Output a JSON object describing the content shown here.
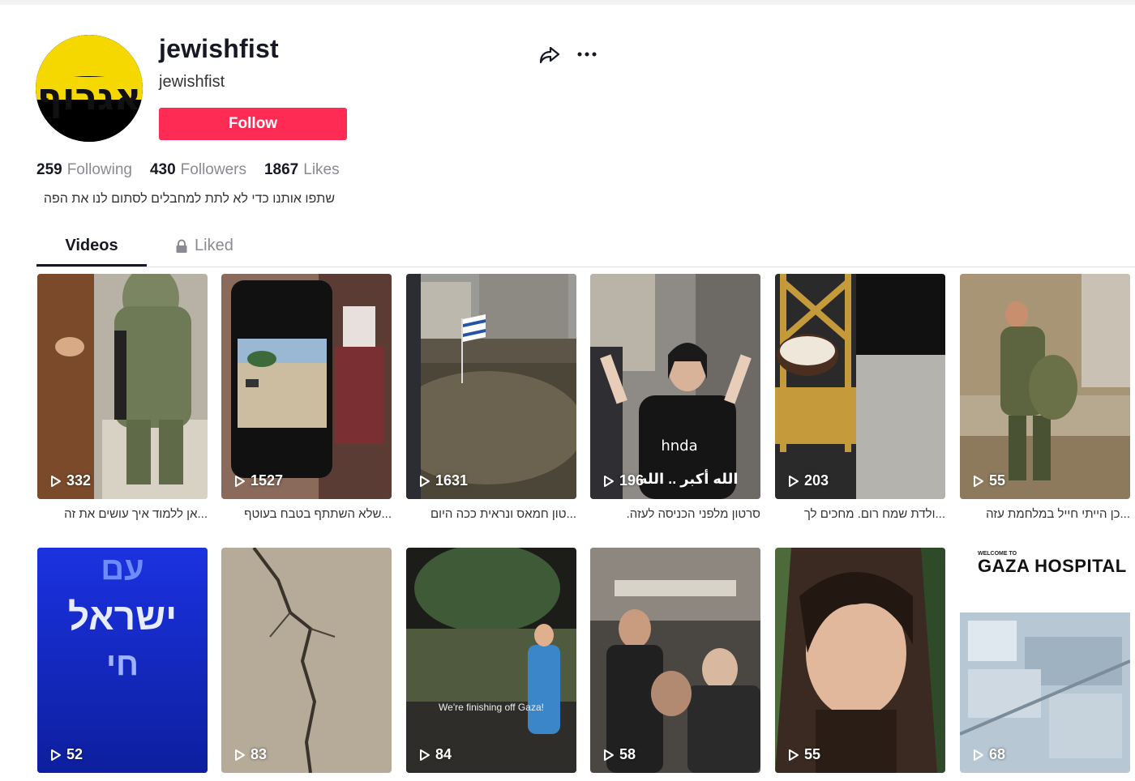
{
  "profile": {
    "username": "jewishfist",
    "nickname": "jewishfist",
    "follow_label": "Follow",
    "avatar_text": "אגרוף",
    "bio": "שתפו אותנו כדי לא לתת למחבלים לסתום לנו את הפה"
  },
  "stats": [
    {
      "value": "259",
      "label": "Following"
    },
    {
      "value": "430",
      "label": "Followers"
    },
    {
      "value": "1867",
      "label": "Likes"
    }
  ],
  "tabs": {
    "videos": "Videos",
    "liked": "Liked"
  },
  "videos": [
    {
      "views": "332",
      "caption": "...אן ללמוד איך עושים את זה"
    },
    {
      "views": "1527",
      "caption": "...שלא השתתף בטבח בעוטף"
    },
    {
      "views": "1631",
      "caption": "...טון חמאס ונראית ככה היום"
    },
    {
      "views": "196",
      "caption": "סרטון מלפני הכניסה לעזה.",
      "overlay": "الله أكبر .. الله"
    },
    {
      "views": "203",
      "caption": "...ולדת שמח רום. מחכים לך"
    },
    {
      "views": "55",
      "caption": "...כן הייתי חייל במלחמת עזה"
    },
    {
      "views": "52",
      "overlay_lines": [
        "עם",
        "ישראל",
        "חי"
      ]
    },
    {
      "views": "83"
    },
    {
      "views": "84",
      "overlay": "We're finishing off Gaza!"
    },
    {
      "views": "58"
    },
    {
      "views": "55"
    },
    {
      "views": "68",
      "overlay_small": "WELCOME TO",
      "overlay": "GAZA HOSPITAL"
    }
  ],
  "colors": {
    "follow": "#fe2c55",
    "muted": "#8a8b91",
    "text": "#161823"
  },
  "icons": [
    "share-icon",
    "more-icon",
    "lock-icon",
    "play-icon"
  ]
}
